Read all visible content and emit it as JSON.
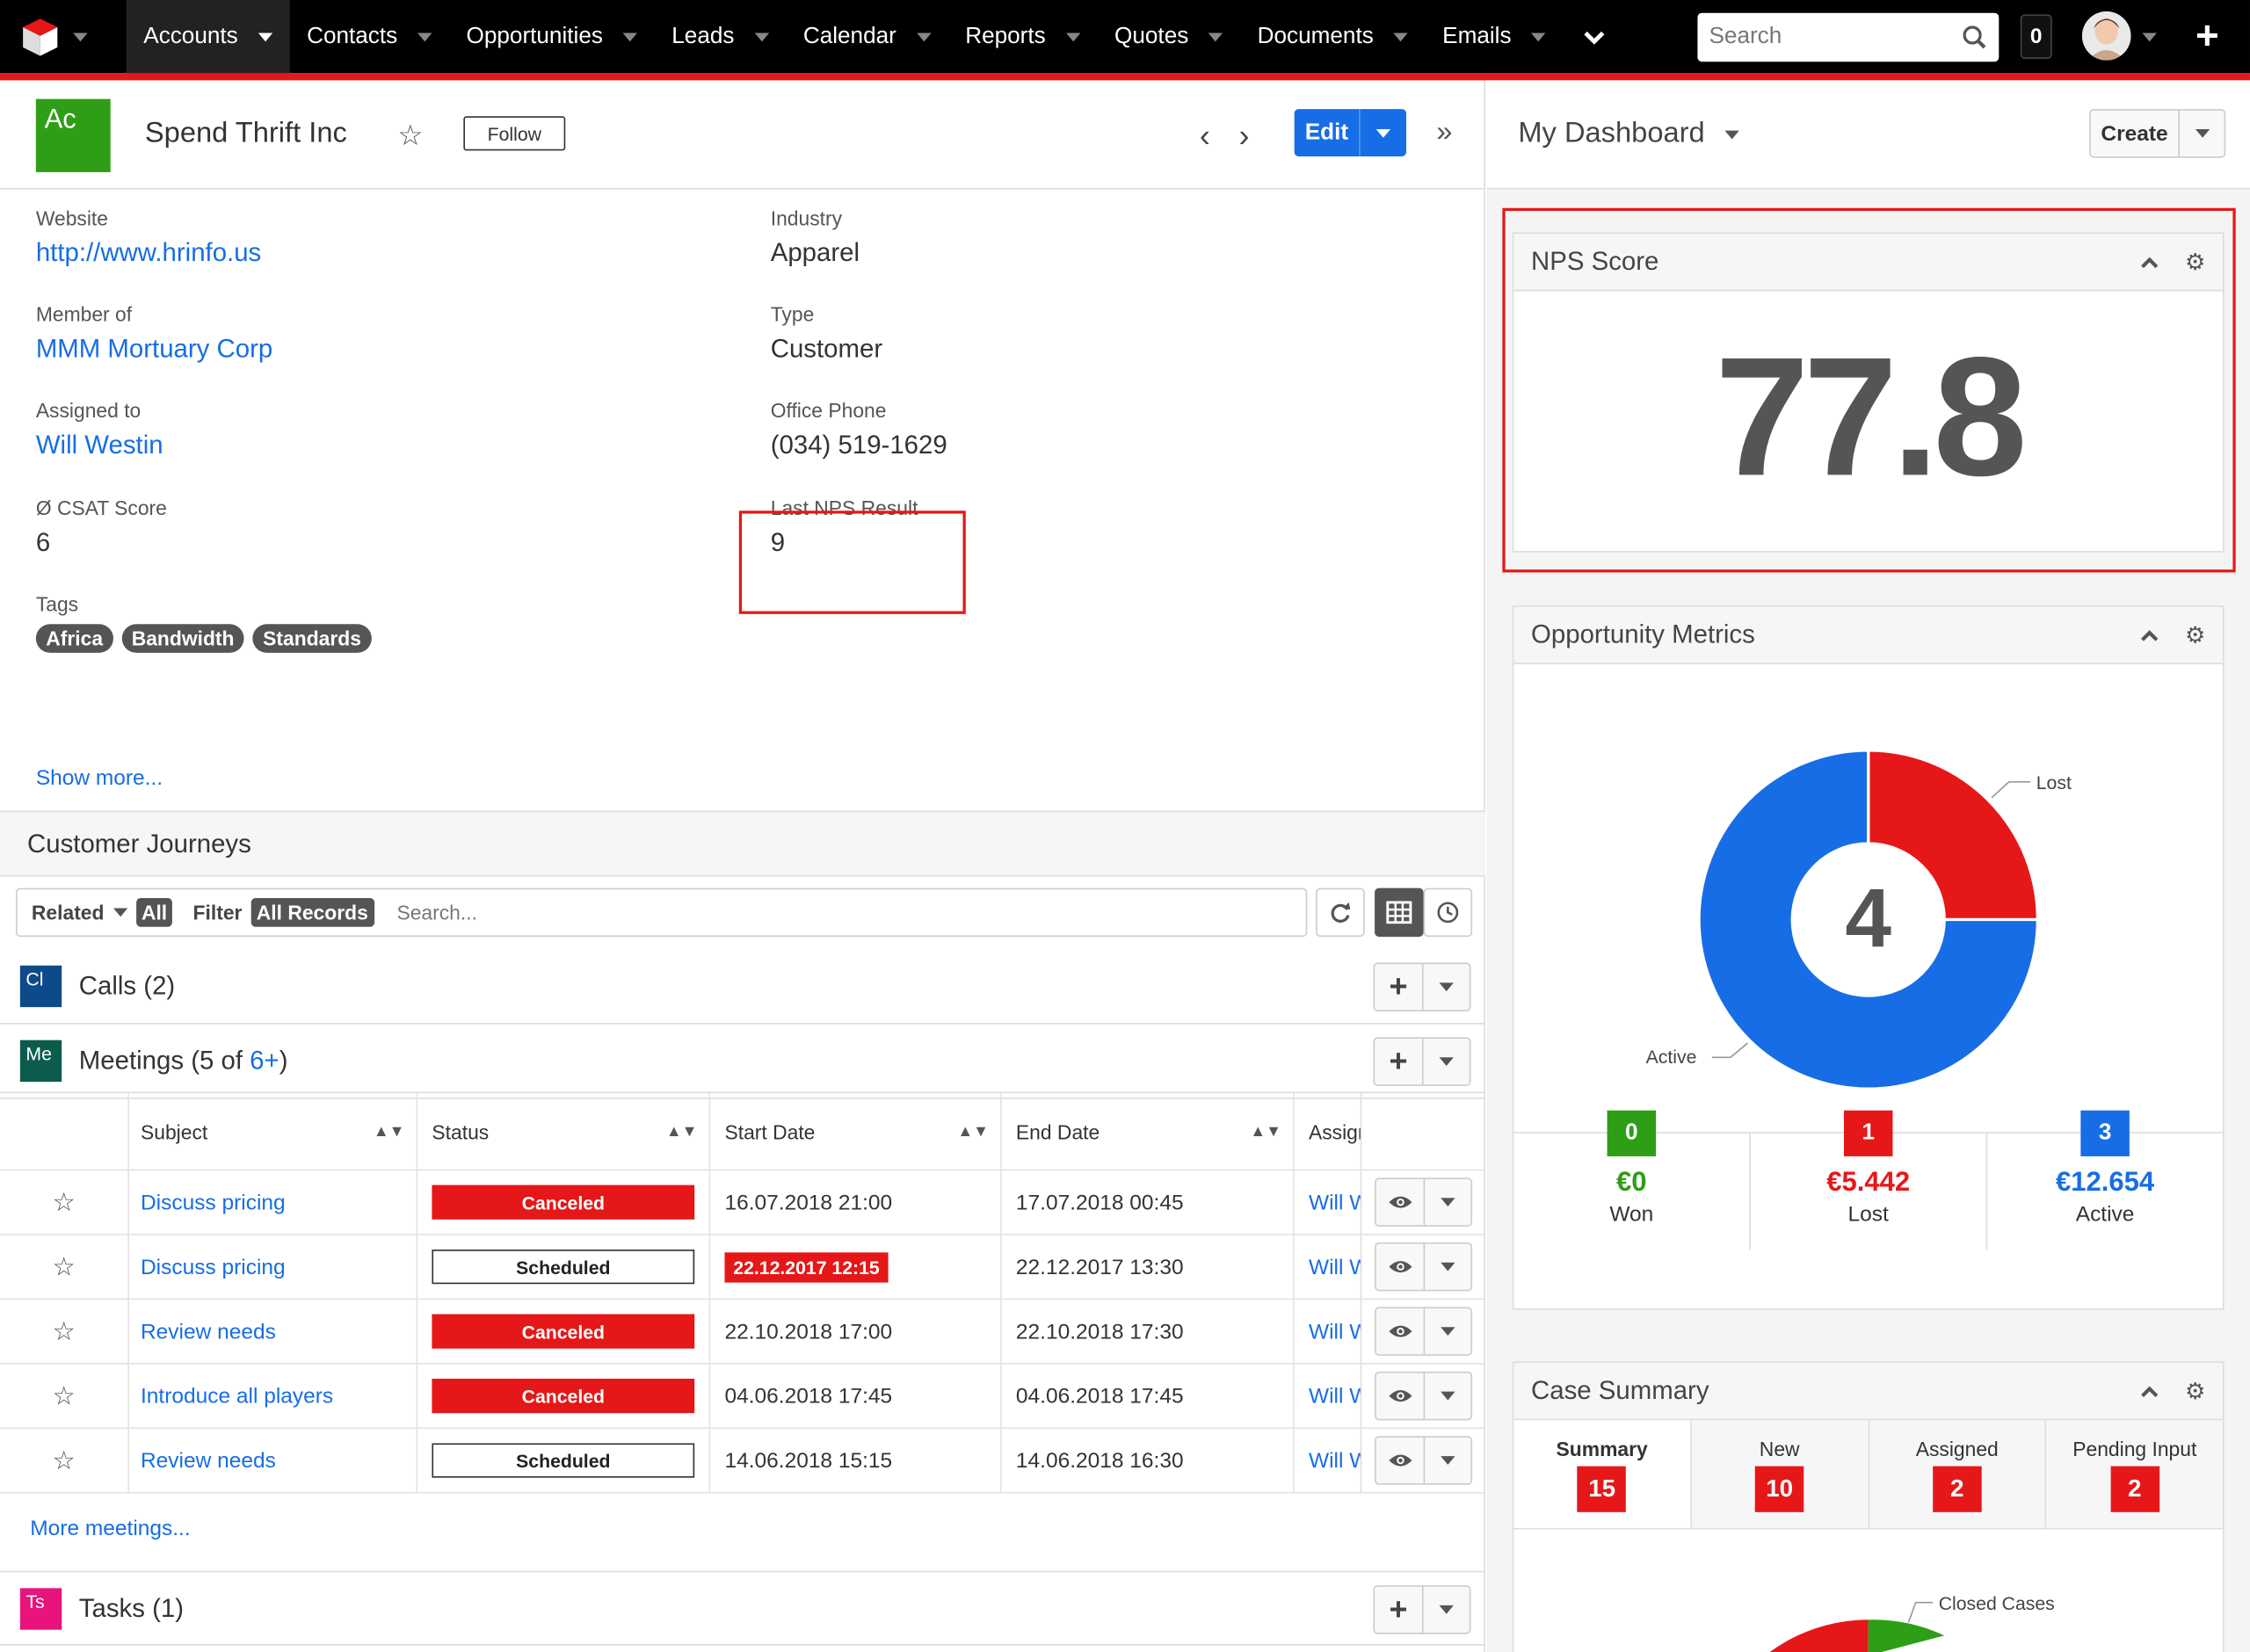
{
  "nav": {
    "items": [
      "Accounts",
      "Contacts",
      "Opportunities",
      "Leads",
      "Calendar",
      "Reports",
      "Quotes",
      "Documents",
      "Emails"
    ],
    "search_placeholder": "Search",
    "notifications": "0"
  },
  "record": {
    "badge": "Ac",
    "title": "Spend Thrift Inc",
    "follow_label": "Follow",
    "edit_label": "Edit",
    "fields": {
      "website_label": "Website",
      "website": "http://www.hrinfo.us",
      "industry_label": "Industry",
      "industry": "Apparel",
      "member_of_label": "Member of",
      "member_of": "MMM Mortuary Corp",
      "type_label": "Type",
      "type": "Customer",
      "assigned_label": "Assigned to",
      "assigned": "Will Westin",
      "phone_label": "Office Phone",
      "phone": "(034) 519-1629",
      "csat_label": "Ø CSAT Score",
      "csat": "6",
      "nps_label": "Last NPS Result",
      "nps": "9",
      "tags_label": "Tags",
      "tags": [
        "Africa",
        "Bandwidth",
        "Standards"
      ]
    },
    "show_more": "Show more..."
  },
  "journeys": {
    "title": "Customer Journeys",
    "related_label": "Related",
    "related_value": "All",
    "filter_label": "Filter",
    "filter_value": "All Records",
    "search_placeholder": "Search...",
    "calls": {
      "badge": "Cl",
      "title": "Calls (2)"
    },
    "meetings": {
      "badge": "Me",
      "title_prefix": "Meetings (5 of ",
      "title_link": "6+",
      "title_suffix": ")"
    },
    "tasks": {
      "badge": "Ts",
      "title": "Tasks (1)"
    },
    "columns": [
      "Subject",
      "Status",
      "Start Date",
      "End Date",
      "Assigned"
    ],
    "rows": [
      {
        "subject": "Discuss pricing",
        "status": "Canceled",
        "status_style": "red",
        "start": "16.07.2018 21:00",
        "start_overdue": false,
        "end": "17.07.2018 00:45",
        "assigned": "Will Westin"
      },
      {
        "subject": "Discuss pricing",
        "status": "Scheduled",
        "status_style": "white",
        "start": "22.12.2017 12:15",
        "start_overdue": true,
        "end": "22.12.2017 13:30",
        "assigned": "Will Westin"
      },
      {
        "subject": "Review needs",
        "status": "Canceled",
        "status_style": "red",
        "start": "22.10.2018 17:00",
        "start_overdue": false,
        "end": "22.10.2018 17:30",
        "assigned": "Will Westin"
      },
      {
        "subject": "Introduce all players",
        "status": "Canceled",
        "status_style": "red",
        "start": "04.06.2018 17:45",
        "start_overdue": false,
        "end": "04.06.2018 17:45",
        "assigned": "Will Westin"
      },
      {
        "subject": "Review needs",
        "status": "Scheduled",
        "status_style": "white",
        "start": "14.06.2018 15:15",
        "start_overdue": false,
        "end": "14.06.2018 16:30",
        "assigned": "Will Westin"
      }
    ],
    "more_meetings": "More meetings..."
  },
  "dashboard": {
    "title": "My Dashboard",
    "create_label": "Create",
    "nps": {
      "title": "NPS Score",
      "value": "77.8"
    },
    "opps": {
      "title": "Opportunity Metrics",
      "center": "4",
      "lost_label": "Lost",
      "active_label": "Active",
      "lost_fraction": 0.25,
      "active_fraction": 0.75,
      "won": {
        "count": "0",
        "amount": "€0",
        "label": "Won"
      },
      "lost": {
        "count": "1",
        "amount": "€5.442",
        "label": "Lost"
      },
      "active": {
        "count": "3",
        "amount": "€12.654",
        "label": "Active"
      }
    },
    "cases": {
      "title": "Case Summary",
      "tabs": [
        {
          "label": "Summary",
          "count": "15"
        },
        {
          "label": "New",
          "count": "10"
        },
        {
          "label": "Assigned",
          "count": "2"
        },
        {
          "label": "Pending Input",
          "count": "2"
        }
      ],
      "closed_label": "Closed Cases"
    }
  },
  "colors": {
    "accent": "#176de5",
    "red": "#e61718",
    "green": "#2f9e17",
    "navy": "#0d4a8a",
    "teal": "#0b5c4d",
    "pink": "#e8137b"
  }
}
